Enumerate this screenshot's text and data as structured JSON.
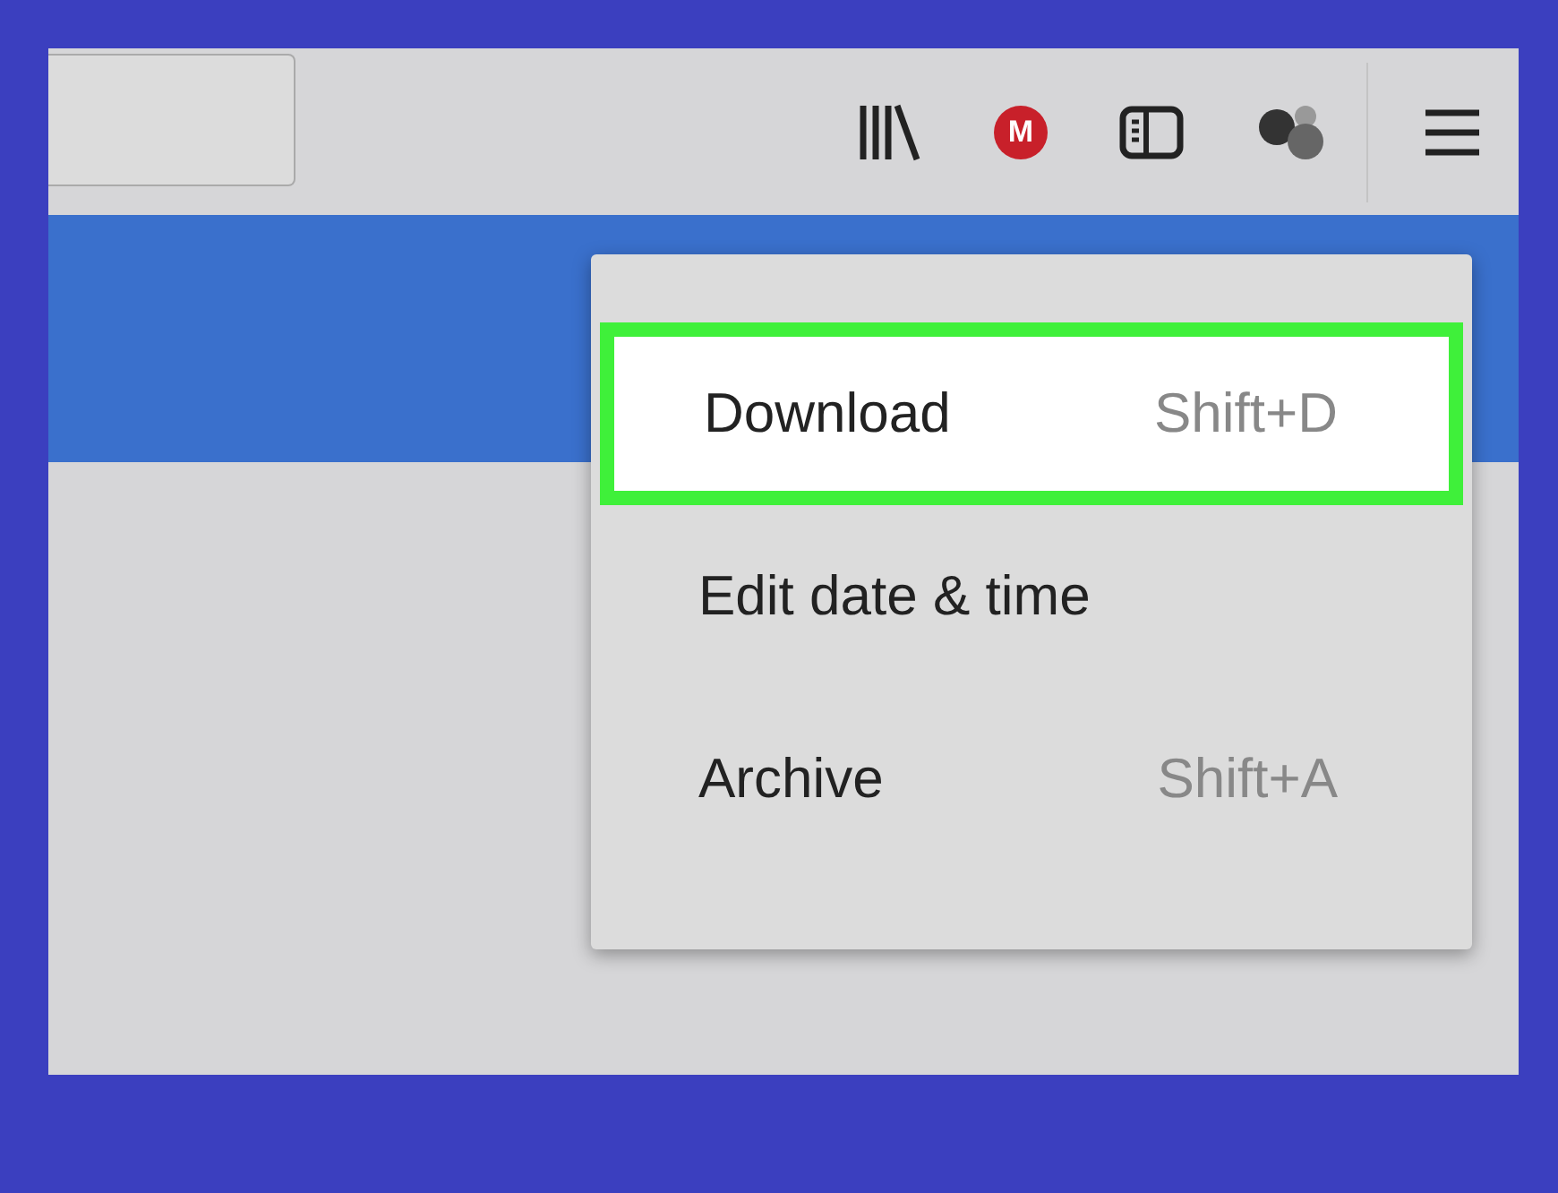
{
  "toolbar": {
    "extension_badge": "M"
  },
  "menu": {
    "items": [
      {
        "label": "Download",
        "shortcut": "Shift+D",
        "highlighted": true
      },
      {
        "label": "Edit date & time",
        "highlighted": false
      },
      {
        "label": "Archive",
        "shortcut": "Shift+A",
        "highlighted": false
      }
    ]
  }
}
